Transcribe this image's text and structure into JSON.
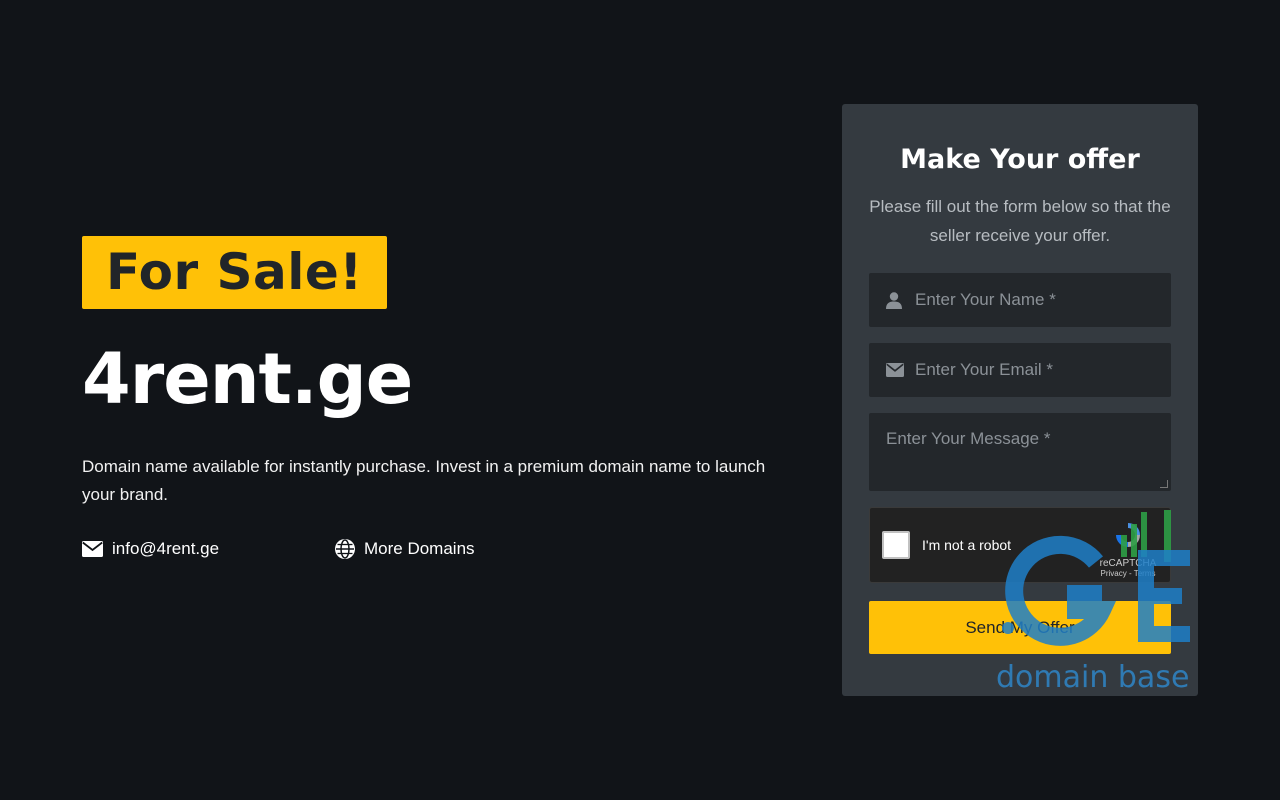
{
  "hero": {
    "badge": "For Sale!",
    "domain": "4rent.ge",
    "description": "Domain name available for instantly purchase. Invest in a premium domain name to launch your brand.",
    "email": "info@4rent.ge",
    "more_domains": "More Domains"
  },
  "offer_form": {
    "title": "Make Your offer",
    "subtitle": "Please fill out the form below so that the seller receive your offer.",
    "name_placeholder": "Enter Your Name *",
    "email_placeholder": "Enter Your Email *",
    "message_placeholder": "Enter Your Message *",
    "captcha_label": "I'm not a robot",
    "captcha_brand": "reCAPTCHA",
    "captcha_links": "Privacy - Terms",
    "submit_label": "Send My Offer"
  },
  "watermark": {
    "text": "domain base"
  },
  "colors": {
    "background": "#111418",
    "accent": "#ffc107",
    "card": "#343a40",
    "input": "#23272b"
  },
  "icons": {
    "email": "envelope-icon",
    "more_domains": "globe-icon",
    "name_field": "user-icon",
    "email_field": "envelope-icon"
  }
}
